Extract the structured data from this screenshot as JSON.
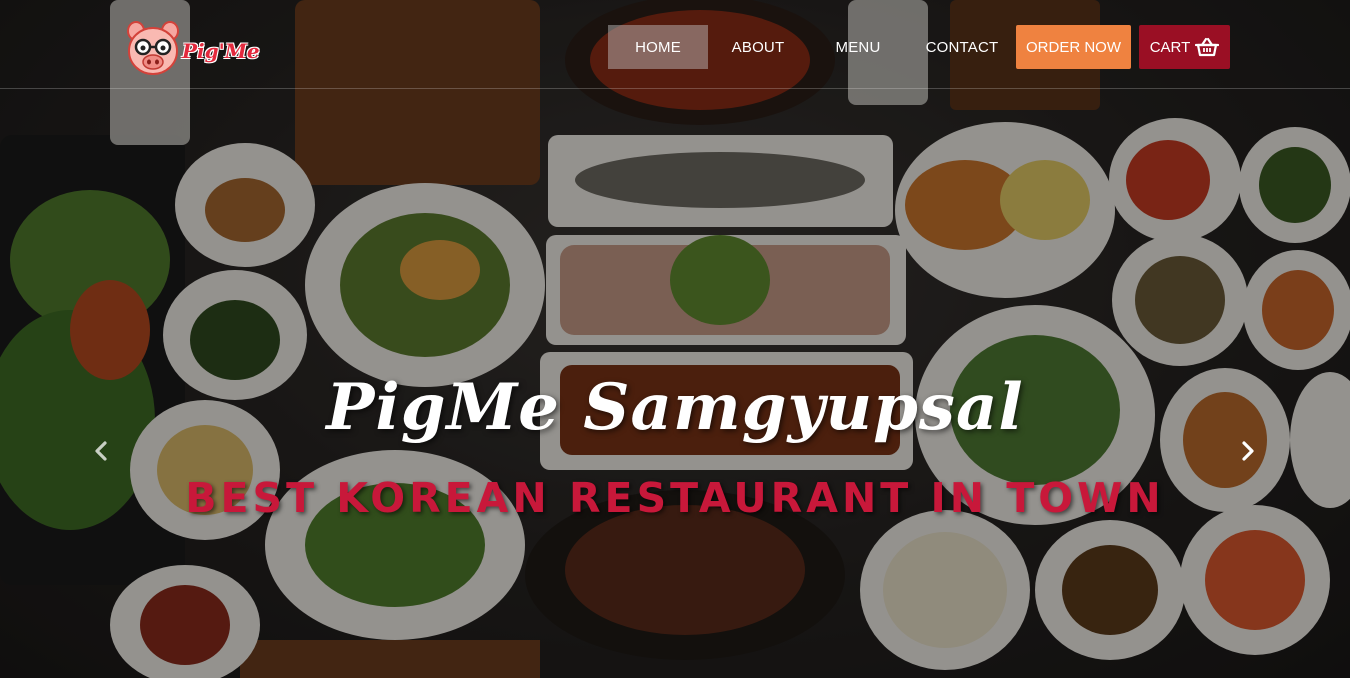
{
  "brand": {
    "logo_text": "Pig'Me",
    "logo_color": "#e3293d"
  },
  "nav": {
    "home": "HOME",
    "about": "ABOUT",
    "menu": "MENU",
    "contact": "CONTACT",
    "order_now": "ORDER NOW",
    "cart": "CART"
  },
  "colors": {
    "order_button": "#ef8240",
    "cart_button": "#9a0f24",
    "subtitle": "#c8183a"
  },
  "hero": {
    "title": "PigMe Samgyupsal",
    "subtitle": "BEST KOREAN RESTAURANT IN TOWN",
    "prev_icon": "chevron-left-icon",
    "next_icon": "chevron-right-icon"
  }
}
